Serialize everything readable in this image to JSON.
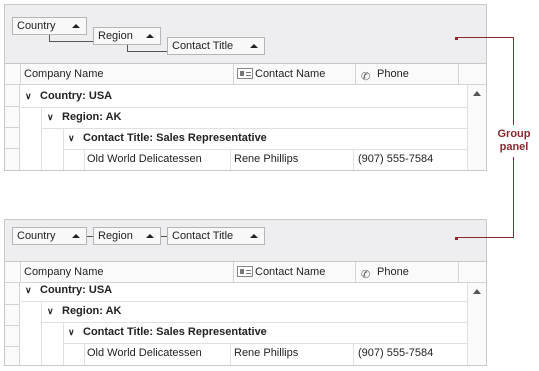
{
  "grid_top": {
    "group_panel": {
      "style": "tree",
      "buttons": [
        {
          "label": "Country"
        },
        {
          "label": "Region"
        },
        {
          "label": "Contact Title"
        }
      ]
    },
    "columns": {
      "company": "Company Name",
      "contact": "Contact Name",
      "phone": "Phone"
    },
    "groups": [
      {
        "text": "Country: USA"
      },
      {
        "text": "Region: AK"
      },
      {
        "text": "Contact Title: Sales Representative"
      }
    ],
    "row": {
      "company": "Old World Delicatessen",
      "contact": "Rene Phillips",
      "phone": "(907) 555-7584"
    }
  },
  "grid_bottom": {
    "group_panel": {
      "style": "line",
      "buttons": [
        {
          "label": "Country"
        },
        {
          "label": "Region"
        },
        {
          "label": "Contact Title"
        }
      ]
    },
    "columns": {
      "company": "Company Name",
      "contact": "Contact Name",
      "phone": "Phone"
    },
    "groups": [
      {
        "text": "Country: USA"
      },
      {
        "text": "Region: AK"
      },
      {
        "text": "Contact Title: Sales Representative"
      }
    ],
    "row": {
      "company": "Old World Delicatessen",
      "contact": "Rene Phillips",
      "phone": "(907) 555-7584"
    }
  },
  "callout": {
    "line1": "Group",
    "line2": "panel"
  },
  "colors": {
    "accent": "#8a2830",
    "panel_bg": "#eeeef1",
    "border": "#c8c8c8"
  },
  "icons": {
    "contact_column": "contact-card-icon",
    "phone_column": "phone-icon",
    "group_toggle": "chevron-down-icon",
    "sort": "sort-ascending-icon",
    "scroll": "scroll-up-icon"
  }
}
